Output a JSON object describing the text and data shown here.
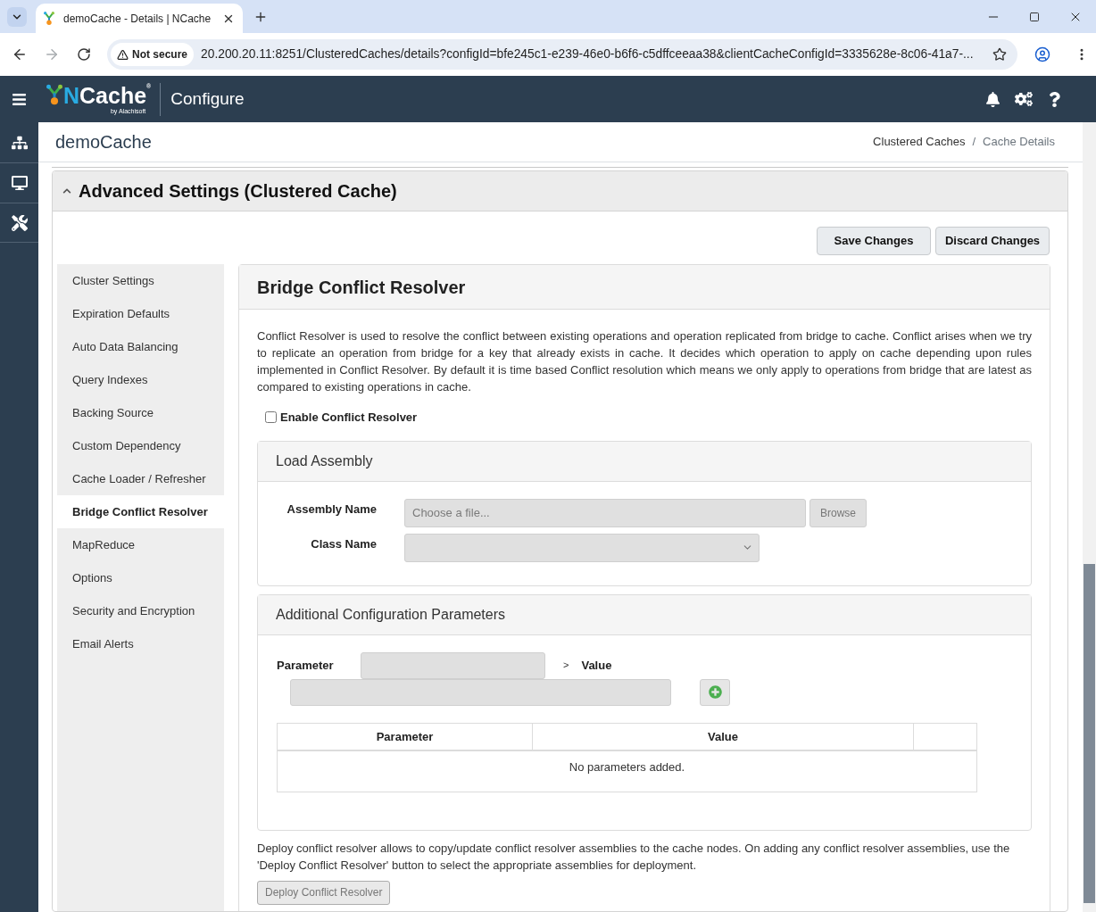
{
  "browser": {
    "tab_title": "demoCache - Details | NCache",
    "security_label": "Not secure",
    "url": "20.200.20.11:8251/ClusteredCaches/details?configId=bfe245c1-e239-46e0-b6f6-c5dffceeaa38&clientCacheConfigId=3335628e-8c06-41a7-...",
    "forward_disabled": true
  },
  "app_header": {
    "logo_text": "NCache",
    "logo_mark": "®",
    "logo_tagline": "by Alachisoft",
    "section": "Configure"
  },
  "page": {
    "title": "demoCache",
    "breadcrumb_separator": "/",
    "breadcrumbs": [
      {
        "label": "Clustered Caches",
        "selected": false
      },
      {
        "label": "Cache Details",
        "selected": true
      }
    ]
  },
  "panel": {
    "title": "Advanced Settings (Clustered Cache)",
    "expanded": true,
    "buttons": [
      "Save Changes",
      "Discard Changes"
    ]
  },
  "nav": [
    {
      "label": "Cluster Settings",
      "selected": false
    },
    {
      "label": "Expiration Defaults",
      "selected": false
    },
    {
      "label": "Auto Data Balancing",
      "selected": false
    },
    {
      "label": "Query Indexes",
      "selected": false
    },
    {
      "label": "Backing Source",
      "selected": false
    },
    {
      "label": "Custom Dependency",
      "selected": false
    },
    {
      "label": "Cache Loader / Refresher",
      "selected": false
    },
    {
      "label": "Bridge Conflict Resolver",
      "selected": true
    },
    {
      "label": "MapReduce",
      "selected": false
    },
    {
      "label": "Options",
      "selected": false
    },
    {
      "label": "Security and Encryption",
      "selected": false
    },
    {
      "label": "Email Alerts",
      "selected": false
    }
  ],
  "resolver": {
    "title": "Bridge Conflict Resolver",
    "description": "Conflict Resolver is used to resolve the conflict between existing operations and operation replicated from bridge to cache. Conflict arises when we try to replicate an operation from bridge for a key that already exists in cache. It decides which operation to apply on cache depending upon rules implemented in Conflict Resolver. By default it is time based Conflict resolution which means we only apply to operations from bridge that are latest as compared to existing operations in cache.",
    "enable_checkbox": {
      "label": "Enable Conflict Resolver",
      "checked": false
    },
    "load_assembly": {
      "title": "Load Assembly",
      "fields": [
        {
          "kind": "file",
          "label": "Assembly Name",
          "placeholder": "Choose a file...",
          "button": "Browse",
          "disabled": true
        },
        {
          "kind": "select",
          "label": "Class Name",
          "disabled": true
        }
      ]
    },
    "additional_parameters": {
      "title": "Additional Configuration Parameters",
      "parameter_label": "Parameter",
      "arrow": ">",
      "value_label": "Value",
      "disabled": true,
      "table": {
        "columns": [
          "Parameter",
          "Value"
        ],
        "empty_message": "No parameters added."
      }
    },
    "deploy_note": "Deploy conflict resolver allows to copy/update conflict resolver assemblies to the cache nodes. On adding any conflict resolver assemblies, use the 'Deploy Conflict Resolver' button to select the appropriate assemblies for deployment.",
    "deploy_button": {
      "label": "Deploy Conflict Resolver",
      "disabled": true
    }
  }
}
